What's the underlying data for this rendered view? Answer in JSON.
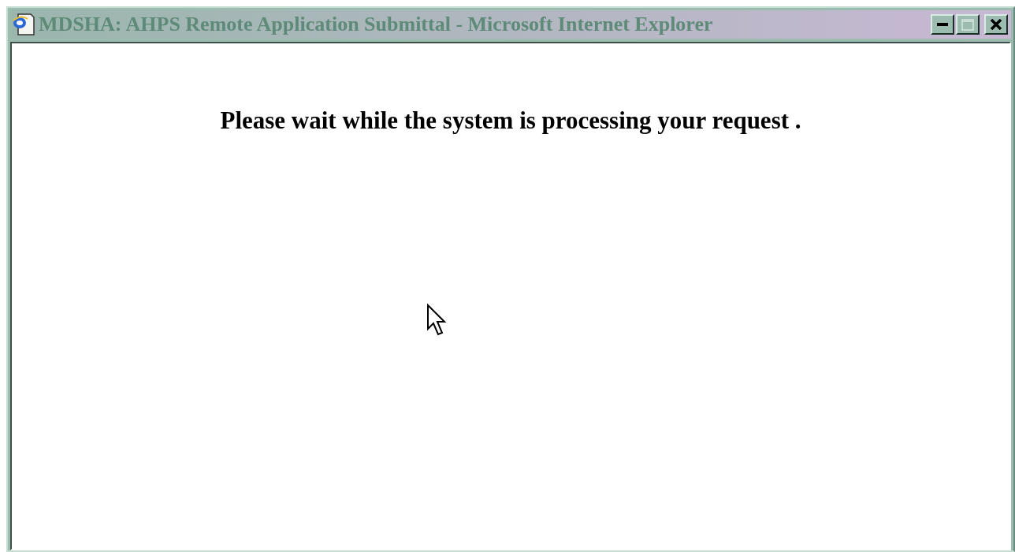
{
  "window": {
    "title": "MDSHA: AHPS Remote Application Submittal - Microsoft Internet Explorer",
    "active": false,
    "controls": [
      {
        "kind": "minimize",
        "disabled": false
      },
      {
        "kind": "maximize",
        "disabled": true
      },
      {
        "kind": "close",
        "disabled": false
      }
    ]
  },
  "page": {
    "message": "Please wait while the system is processing your request ."
  }
}
